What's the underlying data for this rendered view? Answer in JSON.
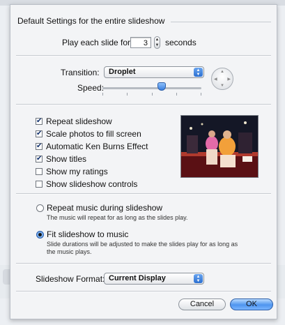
{
  "dialog": {
    "title": "Default Settings for the entire slideshow"
  },
  "timing": {
    "play_prefix": "Play each slide for",
    "seconds_value": "3",
    "seconds_suffix": "seconds"
  },
  "transition": {
    "label": "Transition:",
    "selected": "Droplet",
    "speed_label": "Speed:",
    "speed_level_fraction": 0.6
  },
  "options": {
    "items": [
      {
        "label": "Repeat slideshow",
        "checked": true
      },
      {
        "label": "Scale photos to fill screen",
        "checked": true
      },
      {
        "label": "Automatic Ken Burns Effect",
        "checked": true
      },
      {
        "label": "Show titles",
        "checked": true
      },
      {
        "label": "Show my ratings",
        "checked": false
      },
      {
        "label": "Show slideshow controls",
        "checked": false
      }
    ]
  },
  "music": {
    "repeat_label": "Repeat music during slideshow",
    "repeat_desc": "The music will repeat for as long as the slides play.",
    "repeat_selected": false,
    "fit_label": "Fit slideshow to music",
    "fit_desc_line1": "Slide durations will be adjusted to make the slides play for as long as",
    "fit_desc_line2": "the music plays.",
    "fit_selected": true
  },
  "format": {
    "label": "Slideshow Format:",
    "selected": "Current Display"
  },
  "buttons": {
    "cancel": "Cancel",
    "ok": "OK"
  },
  "colors": {
    "accent": "#3a7fe0",
    "dialog_bg": "#f3f4f6"
  },
  "icons": {
    "check": "✔",
    "popup_arrows": "▲▼"
  }
}
